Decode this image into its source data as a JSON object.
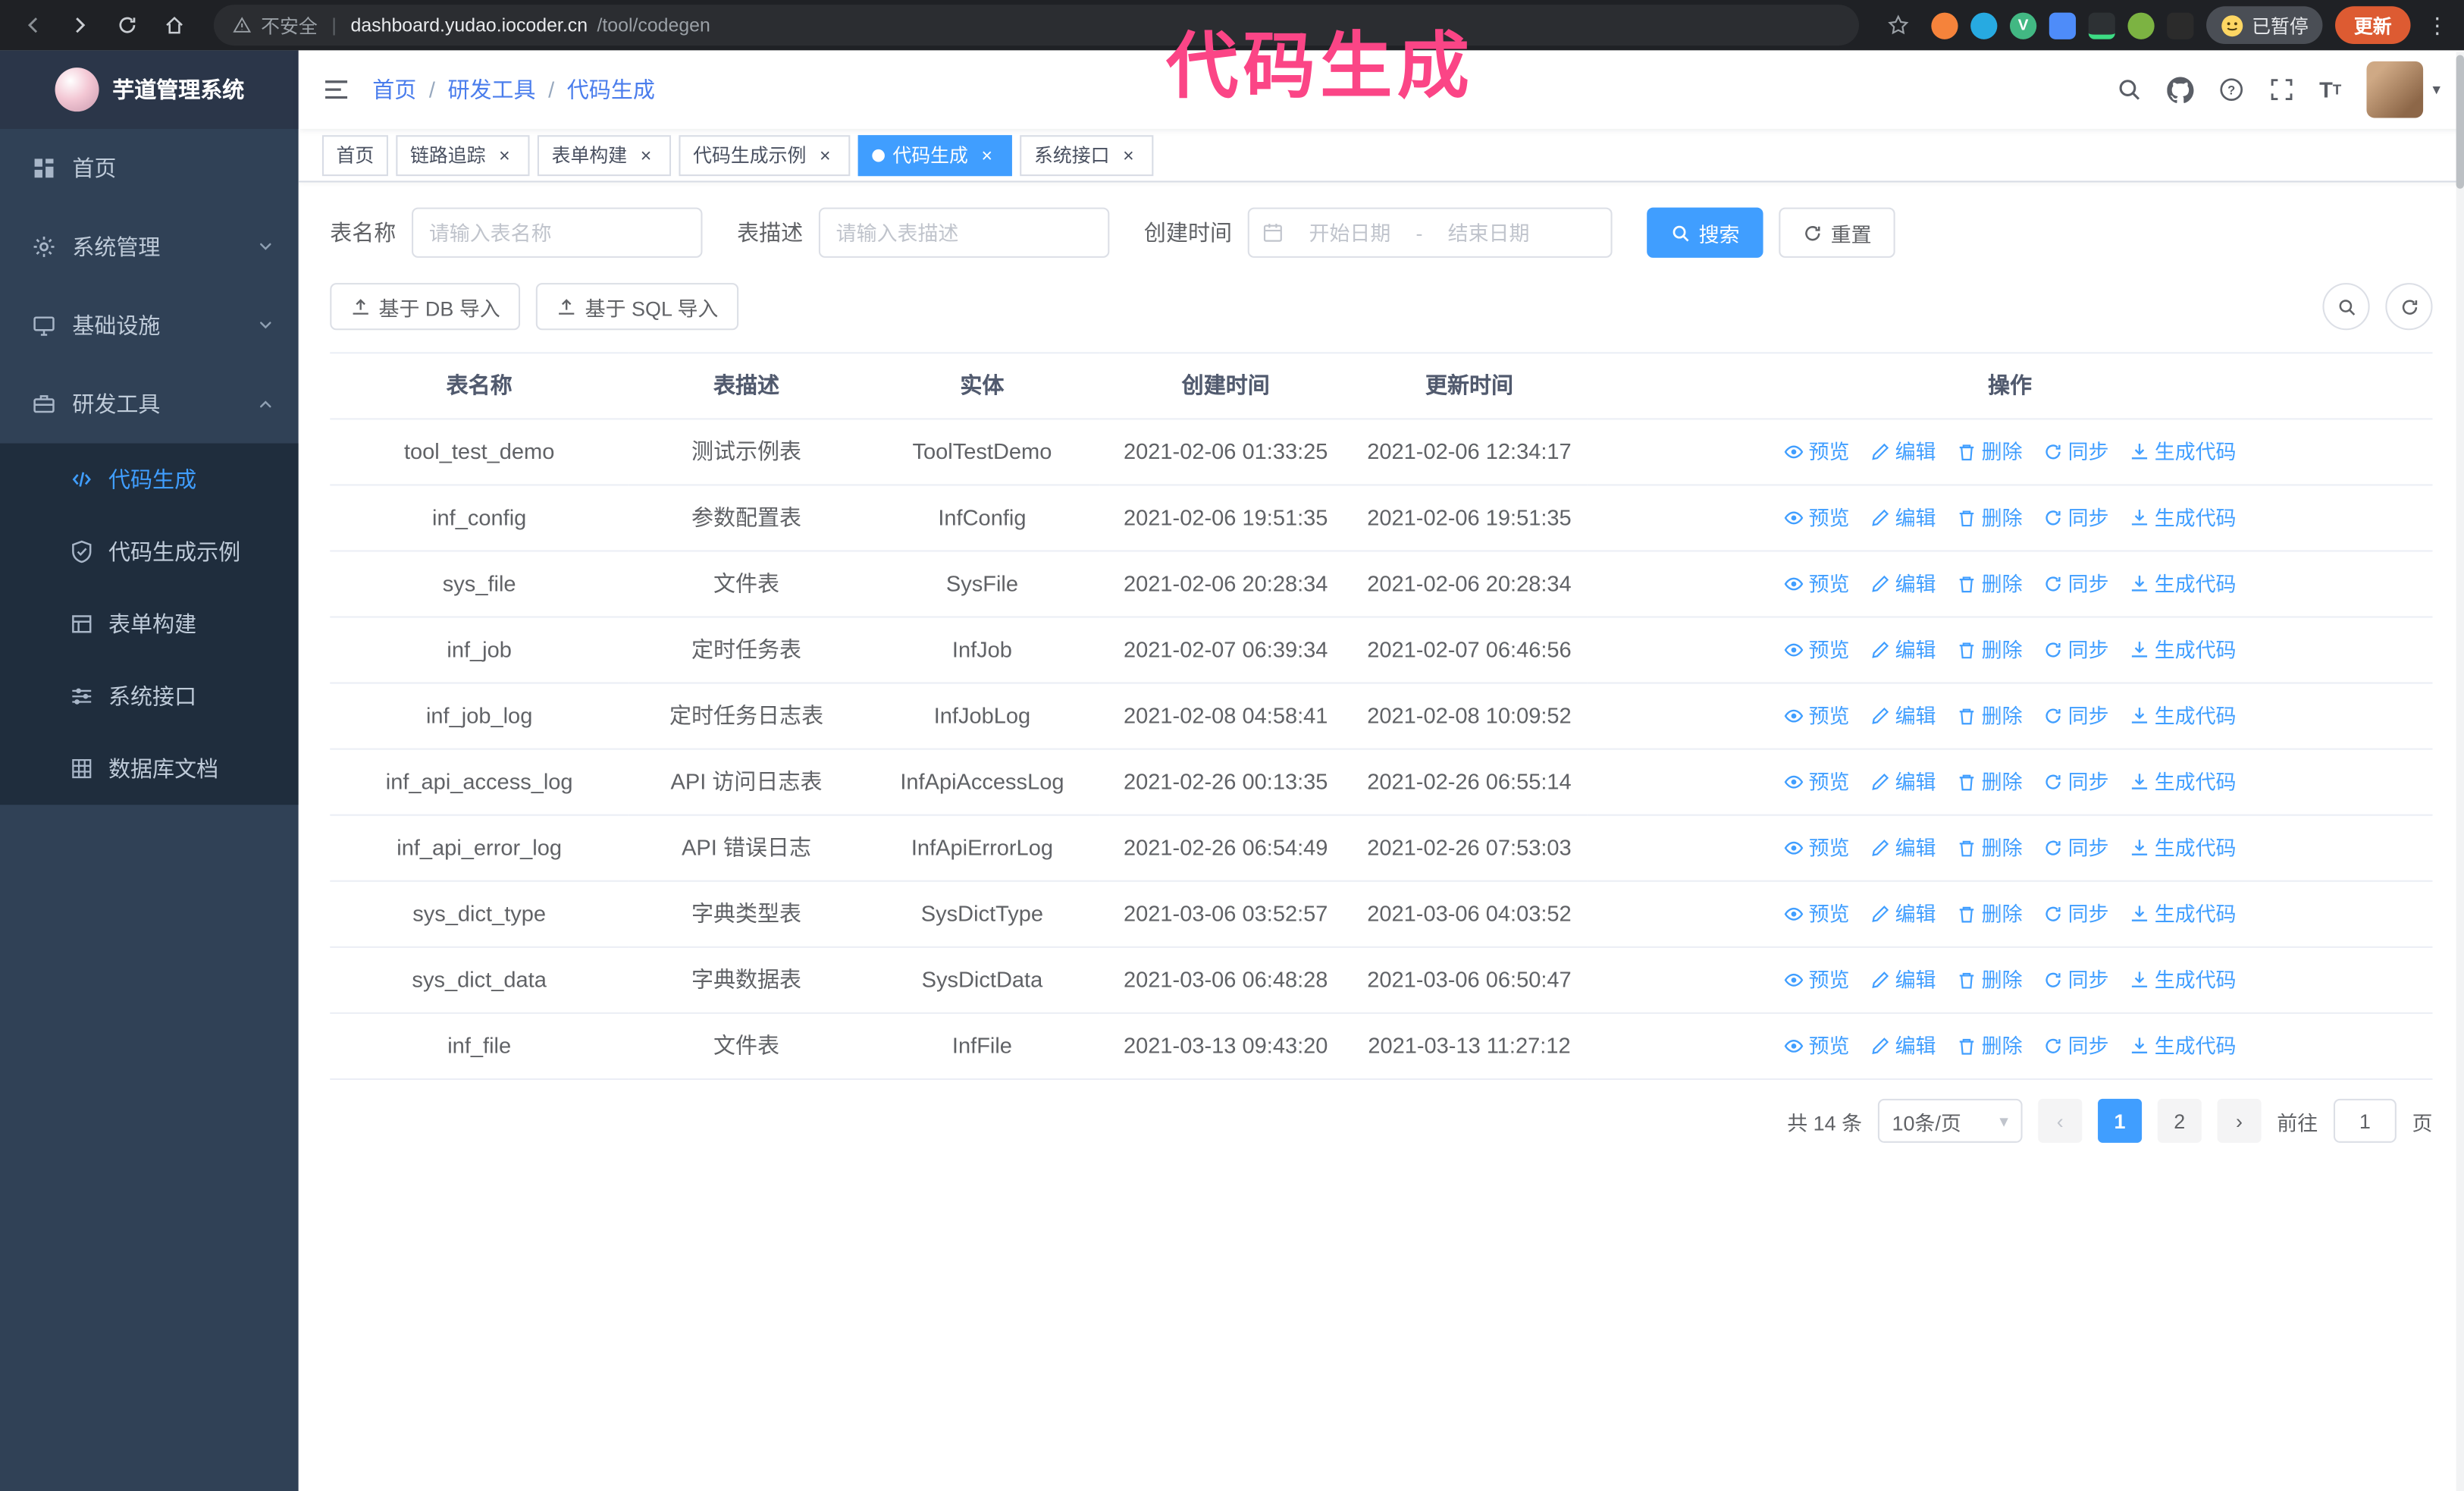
{
  "browser": {
    "warning_text": "不安全",
    "url_domain": "dashboard.yudao.iocoder.cn",
    "url_path": "/tool/codegen",
    "paused_badge": "已暂停",
    "update_button": "更新"
  },
  "annotation": "代码生成",
  "sidebar": {
    "logo_title": "芋道管理系统",
    "items": [
      {
        "label": "首页"
      },
      {
        "label": "系统管理"
      },
      {
        "label": "基础设施"
      },
      {
        "label": "研发工具"
      }
    ],
    "dev_tools_children": [
      {
        "label": "代码生成"
      },
      {
        "label": "代码生成示例"
      },
      {
        "label": "表单构建"
      },
      {
        "label": "系统接口"
      },
      {
        "label": "数据库文档"
      }
    ]
  },
  "header": {
    "breadcrumb": [
      "首页",
      "研发工具",
      "代码生成"
    ],
    "separator": "/"
  },
  "tabs": [
    {
      "label": "首页",
      "active": false,
      "closable": false
    },
    {
      "label": "链路追踪",
      "active": false,
      "closable": true
    },
    {
      "label": "表单构建",
      "active": false,
      "closable": true
    },
    {
      "label": "代码生成示例",
      "active": false,
      "closable": true
    },
    {
      "label": "代码生成",
      "active": true,
      "closable": true
    },
    {
      "label": "系统接口",
      "active": false,
      "closable": true
    }
  ],
  "filters": {
    "table_name_label": "表名称",
    "table_name_placeholder": "请输入表名称",
    "table_desc_label": "表描述",
    "table_desc_placeholder": "请输入表描述",
    "create_time_label": "创建时间",
    "date_start_placeholder": "开始日期",
    "date_separator": "-",
    "date_end_placeholder": "结束日期",
    "search_button": "搜索",
    "reset_button": "重置"
  },
  "toolbar": {
    "import_db_button": "基于 DB 导入",
    "import_sql_button": "基于 SQL 导入"
  },
  "table": {
    "columns": [
      "表名称",
      "表描述",
      "实体",
      "创建时间",
      "更新时间",
      "操作"
    ],
    "actions": [
      "预览",
      "编辑",
      "删除",
      "同步",
      "生成代码"
    ],
    "rows": [
      {
        "name": "tool_test_demo",
        "desc": "测试示例表",
        "entity": "ToolTestDemo",
        "created": "2021-02-06 01:33:25",
        "updated": "2021-02-06 12:34:17"
      },
      {
        "name": "inf_config",
        "desc": "参数配置表",
        "entity": "InfConfig",
        "created": "2021-02-06 19:51:35",
        "updated": "2021-02-06 19:51:35"
      },
      {
        "name": "sys_file",
        "desc": "文件表",
        "entity": "SysFile",
        "created": "2021-02-06 20:28:34",
        "updated": "2021-02-06 20:28:34"
      },
      {
        "name": "inf_job",
        "desc": "定时任务表",
        "entity": "InfJob",
        "created": "2021-02-07 06:39:34",
        "updated": "2021-02-07 06:46:56"
      },
      {
        "name": "inf_job_log",
        "desc": "定时任务日志表",
        "entity": "InfJobLog",
        "created": "2021-02-08 04:58:41",
        "updated": "2021-02-08 10:09:52"
      },
      {
        "name": "inf_api_access_log",
        "desc": "API 访问日志表",
        "entity": "InfApiAccessLog",
        "created": "2021-02-26 00:13:35",
        "updated": "2021-02-26 06:55:14"
      },
      {
        "name": "inf_api_error_log",
        "desc": "API 错误日志",
        "entity": "InfApiErrorLog",
        "created": "2021-02-26 06:54:49",
        "updated": "2021-02-26 07:53:03"
      },
      {
        "name": "sys_dict_type",
        "desc": "字典类型表",
        "entity": "SysDictType",
        "created": "2021-03-06 03:52:57",
        "updated": "2021-03-06 04:03:52"
      },
      {
        "name": "sys_dict_data",
        "desc": "字典数据表",
        "entity": "SysDictData",
        "created": "2021-03-06 06:48:28",
        "updated": "2021-03-06 06:50:47"
      },
      {
        "name": "inf_file",
        "desc": "文件表",
        "entity": "InfFile",
        "created": "2021-03-13 09:43:20",
        "updated": "2021-03-13 11:27:12"
      }
    ]
  },
  "pagination": {
    "total_text": "共 14 条",
    "page_size_text": "10条/页",
    "pages": [
      "1",
      "2"
    ],
    "active_page": "1",
    "goto_prefix": "前往",
    "goto_value": "1",
    "goto_suffix": "页"
  },
  "icons": {
    "close_glyph": "×",
    "caret_glyph": "▾",
    "more_glyph": "⋮",
    "prev_glyph": "‹",
    "next_glyph": "›"
  }
}
